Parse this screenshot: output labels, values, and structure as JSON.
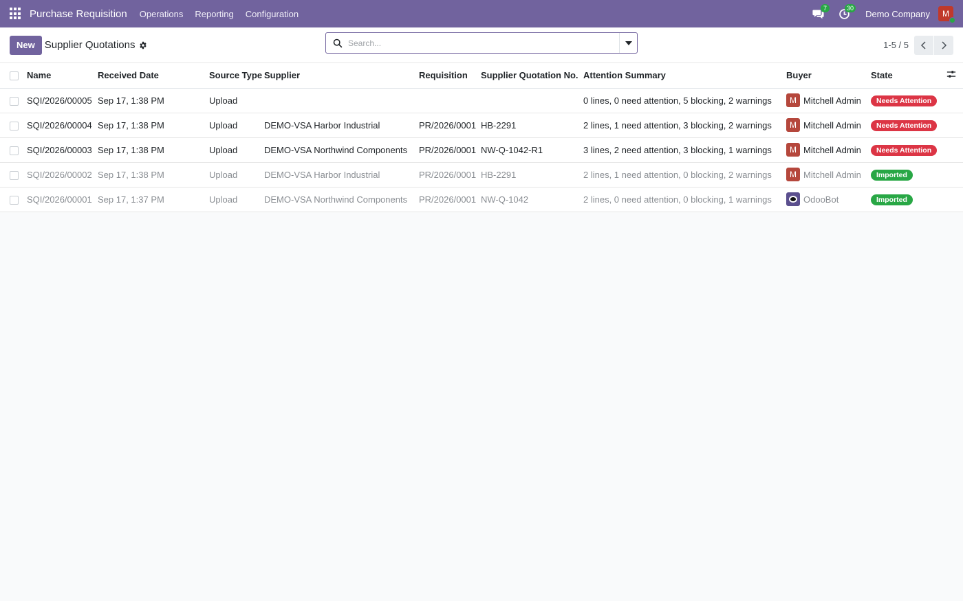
{
  "navbar": {
    "app_title": "Purchase Requisition",
    "menu": [
      "Operations",
      "Reporting",
      "Configuration"
    ],
    "messages_count": "7",
    "activities_count": "30",
    "company": "Demo Company",
    "user_initial": "M"
  },
  "control_panel": {
    "new_label": "New",
    "title": "Supplier Quotations",
    "search_placeholder": "Search...",
    "pager": "1-5 / 5"
  },
  "table": {
    "columns": [
      "Name",
      "Received Date",
      "Source Type",
      "Supplier",
      "Requisition",
      "Supplier Quotation No.",
      "Attention Summary",
      "Buyer",
      "State"
    ],
    "rows": [
      {
        "name": "SQI/2026/00005",
        "date": "Sep 17, 1:38 PM",
        "source": "Upload",
        "supplier": "",
        "requisition": "",
        "quotation_no": "",
        "summary": "0 lines, 0 need attention, 5 blocking, 2 warnings",
        "buyer": "Mitchell Admin",
        "buyer_initial": "M",
        "state": "Needs Attention"
      },
      {
        "name": "SQI/2026/00004",
        "date": "Sep 17, 1:38 PM",
        "source": "Upload",
        "supplier": "DEMO-VSA Harbor Industrial",
        "requisition": "PR/2026/0001",
        "quotation_no": "HB-2291",
        "summary": "2 lines, 1 need attention, 3 blocking, 2 warnings",
        "buyer": "Mitchell Admin",
        "buyer_initial": "M",
        "state": "Needs Attention"
      },
      {
        "name": "SQI/2026/00003",
        "date": "Sep 17, 1:38 PM",
        "source": "Upload",
        "supplier": "DEMO-VSA Northwind Components",
        "requisition": "PR/2026/0001",
        "quotation_no": "NW-Q-1042-R1",
        "summary": "3 lines, 2 need attention, 3 blocking, 1 warnings",
        "buyer": "Mitchell Admin",
        "buyer_initial": "M",
        "state": "Needs Attention"
      },
      {
        "name": "SQI/2026/00002",
        "date": "Sep 17, 1:38 PM",
        "source": "Upload",
        "supplier": "DEMO-VSA Harbor Industrial",
        "requisition": "PR/2026/0001",
        "quotation_no": "HB-2291",
        "summary": "2 lines, 1 need attention, 0 blocking, 2 warnings",
        "buyer": "Mitchell Admin",
        "buyer_initial": "M",
        "state": "Imported"
      },
      {
        "name": "SQI/2026/00001",
        "date": "Sep 17, 1:37 PM",
        "source": "Upload",
        "supplier": "DEMO-VSA Northwind Components",
        "requisition": "PR/2026/0001",
        "quotation_no": "NW-Q-1042",
        "summary": "2 lines, 0 need attention, 0 blocking, 1 warnings",
        "buyer": "OdooBot",
        "buyer_initial": "",
        "state": "Imported"
      }
    ]
  },
  "colors": {
    "brand": "#71639e",
    "needs_attention": "#dc3545",
    "imported": "#28a745"
  }
}
